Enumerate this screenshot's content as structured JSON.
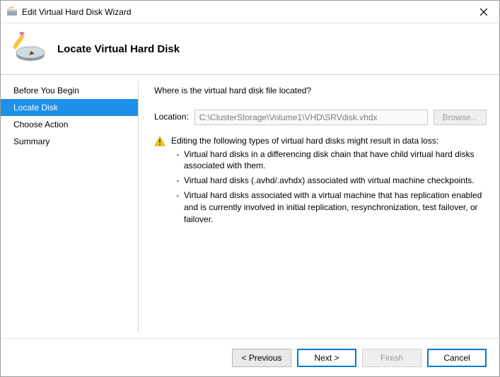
{
  "window": {
    "title": "Edit Virtual Hard Disk Wizard"
  },
  "page": {
    "heading": "Locate Virtual Hard Disk"
  },
  "sidebar": {
    "steps": [
      {
        "label": "Before You Begin"
      },
      {
        "label": "Locate Disk"
      },
      {
        "label": "Choose Action"
      },
      {
        "label": "Summary"
      }
    ],
    "active_index": 1
  },
  "content": {
    "question": "Where is the virtual hard disk file located?",
    "location_label": "Location:",
    "location_value": "C:\\ClusterStorage\\Volume1\\VHD\\SRVdisk.vhdx",
    "browse_label": "Browse...",
    "warning_lead": "Editing the following types of virtual hard disks might result in data loss:",
    "warning_items": [
      "Virtual hard disks in a differencing disk chain that have child virtual hard disks associated with them.",
      "Virtual hard disks (.avhd/.avhdx) associated with virtual machine checkpoints.",
      "Virtual hard disks associated with a virtual machine that has replication enabled and is currently involved in initial replication, resynchronization, test failover, or failover."
    ]
  },
  "footer": {
    "previous": "< Previous",
    "next": "Next >",
    "finish": "Finish",
    "cancel": "Cancel"
  }
}
